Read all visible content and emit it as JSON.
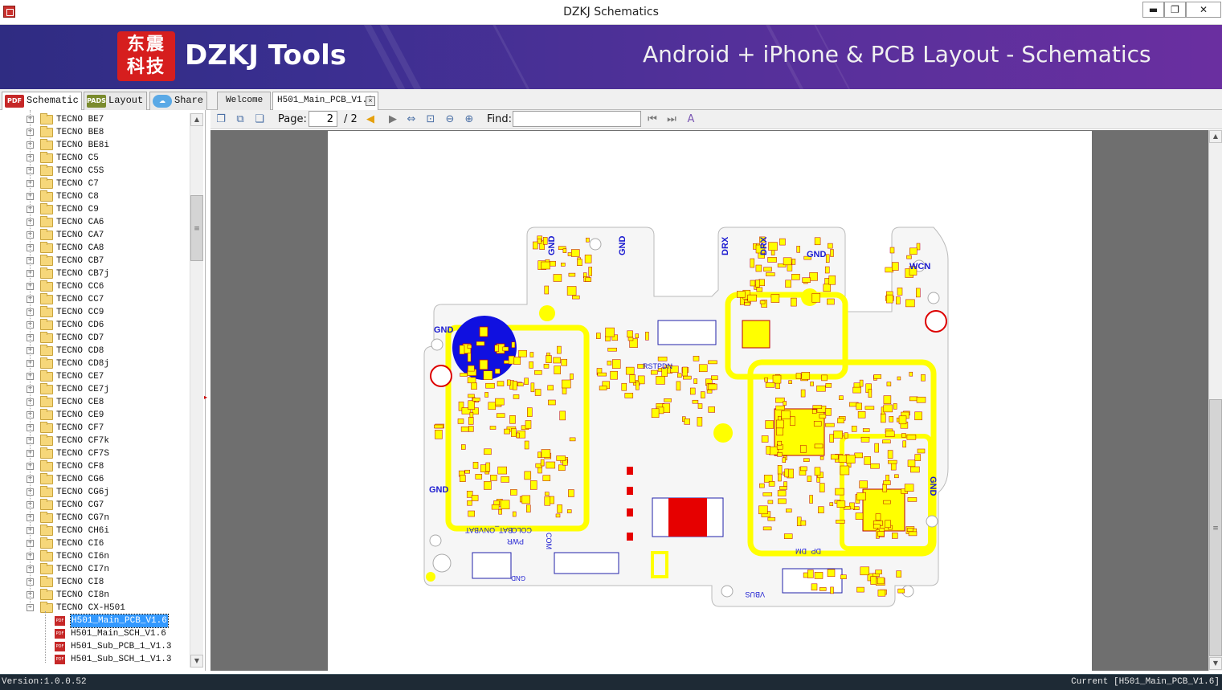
{
  "window": {
    "title": "DZKJ Schematics",
    "min_glyph": "▬",
    "max_glyph": "❐",
    "close_glyph": "✕"
  },
  "banner": {
    "logo_text": "东震\n科技",
    "brand": "DZKJ Tools",
    "tagline": "Android + iPhone & PCB Layout - Schematics"
  },
  "side_tabs": [
    {
      "label": "Schematic",
      "icon": "PDF",
      "icon_color": "#c62828"
    },
    {
      "label": "Layout",
      "icon": "PADS",
      "icon_color": "#7a8b2e"
    },
    {
      "label": "Share",
      "icon": "cloud-icon",
      "icon_color": "#2e86de"
    }
  ],
  "doc_tabs": [
    {
      "label": "Welcome"
    },
    {
      "label": "H501_Main_PCB_V1.6"
    }
  ],
  "toolbar": {
    "page_label": "Page:",
    "page_value": "2",
    "page_total": "/ 2",
    "find_label": "Find:",
    "find_value": ""
  },
  "tree": {
    "items": [
      "TECNO BE7",
      "TECNO BE8",
      "TECNO BE8i",
      "TECNO C5",
      "TECNO C5S",
      "TECNO C7",
      "TECNO C8",
      "TECNO C9",
      "TECNO CA6",
      "TECNO CA7",
      "TECNO CA8",
      "TECNO CB7",
      "TECNO CB7j",
      "TECNO CC6",
      "TECNO CC7",
      "TECNO CC9",
      "TECNO CD6",
      "TECNO CD7",
      "TECNO CD8",
      "TECNO CD8j",
      "TECNO CE7",
      "TECNO CE7j",
      "TECNO CE8",
      "TECNO CE9",
      "TECNO CF7",
      "TECNO CF7k",
      "TECNO CF7S",
      "TECNO CF8",
      "TECNO CG6",
      "TECNO CG6j",
      "TECNO CG7",
      "TECNO CG7n",
      "TECNO CH6i",
      "TECNO CI6",
      "TECNO CI6n",
      "TECNO CI7n",
      "TECNO CI8",
      "TECNO CI8n",
      "TECNO CX-H501"
    ],
    "files": [
      "H501_Main_PCB_V1.6",
      "H501_Main_SCH_V1.6",
      "H501_Sub_PCB_1_V1.3",
      "H501_Sub_SCH_1_V1.3"
    ],
    "selected_file_index": 0
  },
  "pcb": {
    "labels": {
      "gnd": "GND",
      "drx": "DRX",
      "wcn": "WCN",
      "rstpdn": "RSTPDN",
      "vbus": "VBUS",
      "vbat": "VBAT",
      "bat_on": "BAT_ON",
      "colo": "COLO",
      "pwr": "PWR",
      "com": "COM",
      "dp": "DP",
      "dm": "DM",
      "gnd_small": "GND"
    },
    "colors": {
      "board": "#f5f5f5",
      "trace": "#ffff00",
      "component": "#e8e800",
      "red": "#e60000",
      "blue": "#0a0ae0"
    }
  },
  "status": {
    "version": "Version:1.0.0.52",
    "current": "Current [H501_Main_PCB_V1.6]"
  }
}
